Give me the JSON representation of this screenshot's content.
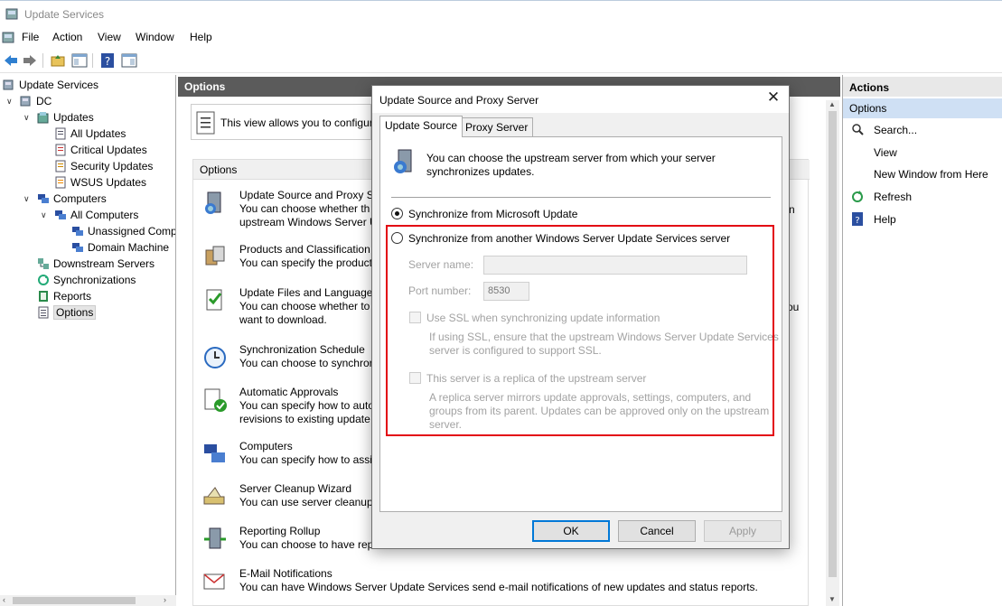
{
  "window": {
    "title": "Update Services"
  },
  "menu": [
    "File",
    "Action",
    "View",
    "Window",
    "Help"
  ],
  "tree": {
    "items": [
      {
        "label": "Update Services",
        "level": 0
      },
      {
        "label": "DC",
        "level": 1
      },
      {
        "label": "Updates",
        "level": 2
      },
      {
        "label": "All Updates",
        "level": 3
      },
      {
        "label": "Critical Updates",
        "level": 3
      },
      {
        "label": "Security Updates",
        "level": 3
      },
      {
        "label": "WSUS Updates",
        "level": 3
      },
      {
        "label": "Computers",
        "level": 2
      },
      {
        "label": "All Computers",
        "level": 3
      },
      {
        "label": "Unassigned Comp",
        "level": 4
      },
      {
        "label": "Domain Machine",
        "level": 4
      },
      {
        "label": "Downstream Servers",
        "level": 2
      },
      {
        "label": "Synchronizations",
        "level": 2
      },
      {
        "label": "Reports",
        "level": 2
      },
      {
        "label": "Options",
        "level": 2,
        "selected": true
      }
    ]
  },
  "center": {
    "header": "Options",
    "info_text": "This view allows you to configur",
    "options_header": "Options",
    "items": [
      {
        "title": "Update Source and Proxy Se",
        "desc1": "You can choose whether th",
        "desc2": "upstream Windows Server U"
      },
      {
        "title": "Products and Classification",
        "desc1": "You can specify the product",
        "desc2": ""
      },
      {
        "title": "Update Files and Languages",
        "desc1": "You can choose whether to",
        "desc2": "want to download."
      },
      {
        "title": "Synchronization Schedule",
        "desc1": "You can choose to synchror",
        "desc2": ""
      },
      {
        "title": "Automatic Approvals",
        "desc1": "You can specify how to auto",
        "desc2": "revisions to existing update"
      },
      {
        "title": "Computers",
        "desc1": "You can specify how to assi",
        "desc2": ""
      },
      {
        "title": "Server Cleanup Wizard",
        "desc1": "You can use server cleanup",
        "desc2": ""
      },
      {
        "title": "Reporting Rollup",
        "desc1": "You can choose to have rep",
        "desc2": ""
      },
      {
        "title": "E-Mail Notifications",
        "desc1": "You can have Windows Server Update Services send e-mail notifications of new updates and status reports.",
        "desc2": ""
      }
    ],
    "overflow_right_1": "n",
    "overflow_right_2": "ou"
  },
  "actions": {
    "header": "Actions",
    "subheader": "Options",
    "items": [
      "Search...",
      "View",
      "New Window from Here",
      "Refresh",
      "Help"
    ]
  },
  "dialog": {
    "title": "Update Source and Proxy Server",
    "tabs": [
      "Update Source",
      "Proxy Server"
    ],
    "intro_line1": "You can choose the upstream server from which your server",
    "intro_line2": "synchronizes updates.",
    "radio_microsoft": "Synchronize from Microsoft Update",
    "radio_wsus": "Synchronize from another Windows Server Update Services server",
    "server_name_label": "Server name:",
    "server_name_value": "",
    "port_label": "Port number:",
    "port_value": "8530",
    "ssl_label": "Use SSL when synchronizing update information",
    "ssl_note1": "If using SSL, ensure that the upstream Windows Server Update Services",
    "ssl_note2": "server is configured to support SSL.",
    "replica_label": "This server is a replica of the upstream server",
    "replica_note1": "A replica server mirrors update approvals, settings, computers, and",
    "replica_note2": "groups from its parent. Updates can be approved only on the upstream",
    "replica_note3": "server.",
    "ok": "OK",
    "cancel": "Cancel",
    "apply": "Apply"
  }
}
